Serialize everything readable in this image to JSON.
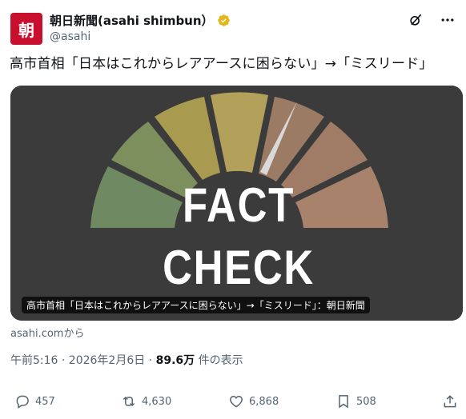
{
  "author": {
    "avatar_glyph": "朝",
    "name": "朝日新聞(asahi shimbun）",
    "handle": "@asahi",
    "verified_icon": "verified-badge-gold"
  },
  "tweet": {
    "text": "高市首相「日本はこれからレアアースに困らない」→「ミスリード」"
  },
  "card": {
    "image_text_top": "FACT",
    "image_text_bottom": "CHECK",
    "caption": "高市首相「日本はこれからレアアースに困らない」→「ミスリード」：朝日新聞",
    "source": "asahi.comから"
  },
  "meta": {
    "time": "午前5:16 · 2026年2月6日 · ",
    "views": "89.6万",
    "views_suffix": " 件の表示"
  },
  "actions": {
    "reply_count": "457",
    "retweet_count": "4,630",
    "like_count": "6,868",
    "bookmark_count": "508"
  },
  "colors": {
    "brand": "#c8102e",
    "verified": "#e2b719",
    "muted": "#536471",
    "gauge": [
      "#6f8a63",
      "#8e9656",
      "#a89a4e",
      "#b3a05a",
      "#9c7b64",
      "#a07c66",
      "#a8826a"
    ]
  }
}
